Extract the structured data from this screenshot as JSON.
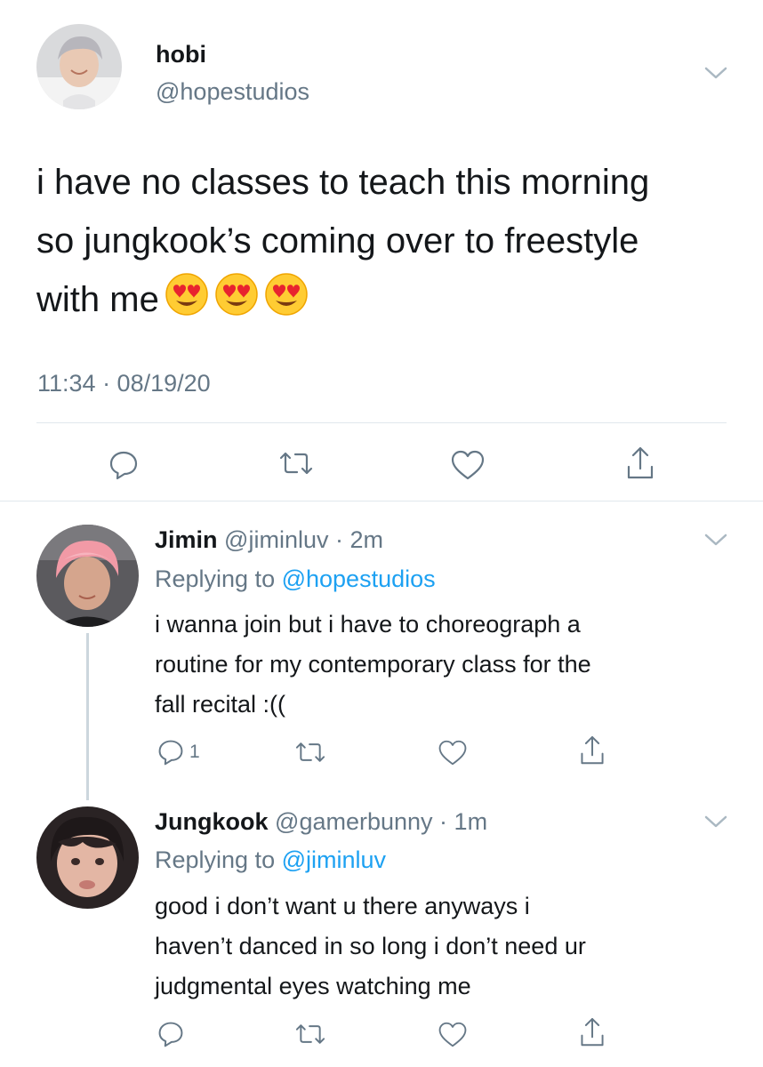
{
  "main_tweet": {
    "name": "hobi",
    "handle": "@hopestudios",
    "text_lines": [
      "i have no classes to teach this morning",
      "so jungkook’s coming over to freestyle",
      "with me"
    ],
    "emojis": [
      "😍",
      "😍",
      "😍"
    ],
    "timestamp": "11:34 · 08/19/20",
    "avatar_icon": "avatar-photo"
  },
  "replies": [
    {
      "name": "Jimin",
      "handle": "@jiminluv",
      "time": "2m",
      "replying_prefix": "Replying to ",
      "replying_to": "@hopestudios",
      "text_lines": [
        "i wanna join but i have to choreograph a",
        "routine for my contemporary class for the",
        "fall recital :(("
      ],
      "reply_count": "1"
    },
    {
      "name": "Jungkook",
      "handle": "@gamerbunny",
      "time": "1m",
      "replying_prefix": "Replying to ",
      "replying_to": "@jiminluv",
      "text_lines": [
        "good i don’t want u there anyways i",
        "haven’t danced in so long i don’t need ur",
        "judgmental eyes watching me"
      ],
      "reply_count": ""
    }
  ],
  "colors": {
    "text": "#14171a",
    "secondary": "#657786",
    "link": "#1da1f2",
    "divider": "#e1e8ed",
    "thread_line": "#ccd6dd"
  },
  "icons": {
    "reply": "reply-icon",
    "retweet": "retweet-icon",
    "like": "heart-icon",
    "share": "share-icon",
    "more": "chevron-down-icon"
  }
}
